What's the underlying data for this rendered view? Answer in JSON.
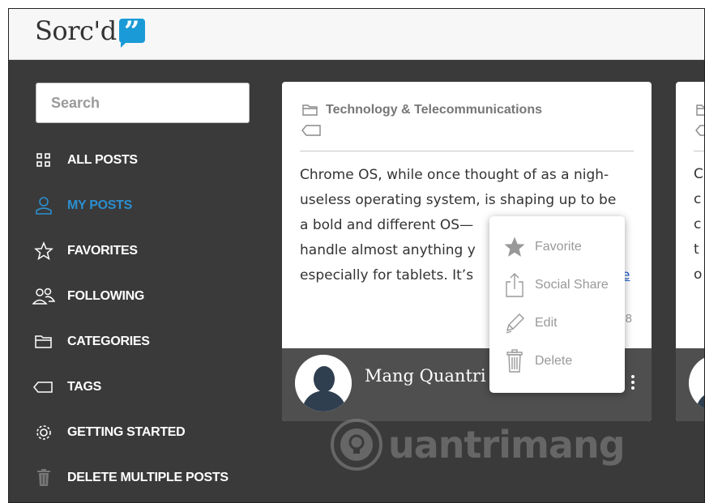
{
  "app": {
    "name": "Sorc'd",
    "logo_glyph": "”",
    "accent": "#1a9bd7"
  },
  "search": {
    "placeholder": "Search"
  },
  "sidebar": {
    "items": [
      {
        "label": "ALL POSTS",
        "icon": "grid-icon"
      },
      {
        "label": "MY POSTS",
        "icon": "user-icon",
        "active": true
      },
      {
        "label": "FAVORITES",
        "icon": "star-outline-icon"
      },
      {
        "label": "FOLLOWING",
        "icon": "people-icon"
      },
      {
        "label": "CATEGORIES",
        "icon": "folder-icon"
      },
      {
        "label": "TAGS",
        "icon": "tag-icon"
      },
      {
        "label": "GETTING STARTED",
        "icon": "gear-icon"
      },
      {
        "label": "DELETE MULTIPLE POSTS",
        "icon": "trash-icon"
      }
    ]
  },
  "card": {
    "category": "Technology & Telecommunications",
    "lines": [
      "Chrome OS, while once thought of as a nigh-",
      "useless operating system, is shaping up to be",
      "a bold and different OS—",
      "handle almost anything y",
      "especially for tablets. It’s"
    ],
    "link_fragment": "e",
    "count_fragment": "8",
    "author": "Mang Quantri"
  },
  "card2": {
    "fragments": [
      "C",
      "c",
      "c",
      "t",
      "o"
    ]
  },
  "context_menu": {
    "items": [
      {
        "label": "Favorite",
        "icon": "star-icon"
      },
      {
        "label": "Social Share",
        "icon": "share-icon"
      },
      {
        "label": "Edit",
        "icon": "pencil-icon"
      },
      {
        "label": "Delete",
        "icon": "trash-icon"
      }
    ]
  },
  "watermark": {
    "text": "uantrimang",
    "icon": "lightbulb-icon"
  }
}
